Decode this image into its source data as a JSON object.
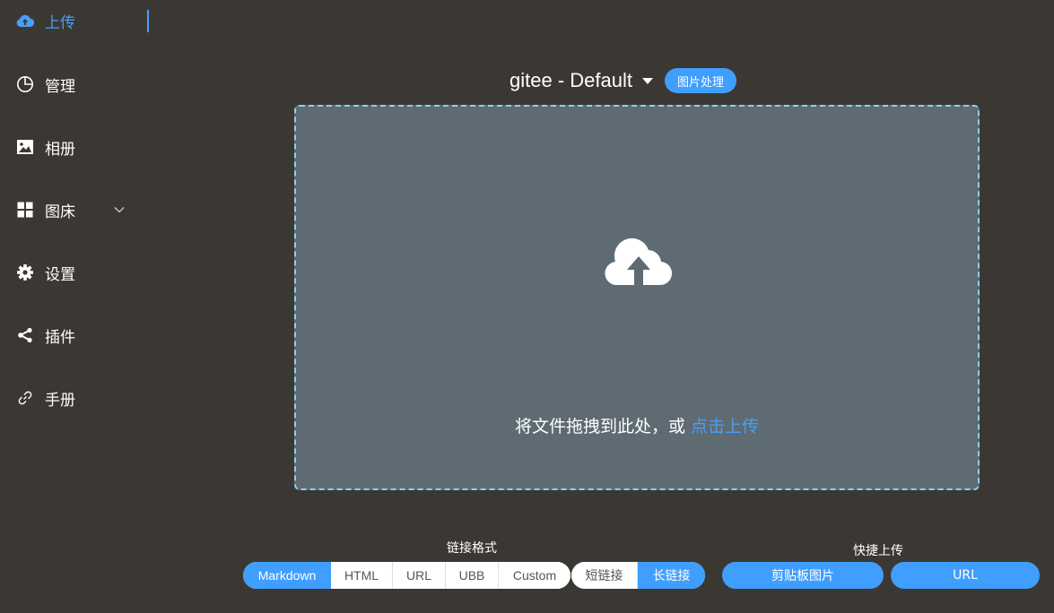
{
  "sidebar": {
    "items": [
      {
        "label": "上传",
        "icon": "cloud-upload-icon"
      },
      {
        "label": "管理",
        "icon": "pie-chart-icon"
      },
      {
        "label": "相册",
        "icon": "picture-icon"
      },
      {
        "label": "图床",
        "icon": "grid-icon"
      },
      {
        "label": "设置",
        "icon": "gear-icon"
      },
      {
        "label": "插件",
        "icon": "share-icon"
      },
      {
        "label": "手册",
        "icon": "link-icon"
      }
    ],
    "active_index": 0
  },
  "header": {
    "picbed_title": "gitee - Default",
    "process_button": "图片处理"
  },
  "dropzone": {
    "text": "将文件拖拽到此处，或 ",
    "link": "点击上传"
  },
  "link_format": {
    "label": "链接格式",
    "options": [
      "Markdown",
      "HTML",
      "URL",
      "UBB",
      "Custom"
    ],
    "selected": "Markdown"
  },
  "link_length": {
    "options": [
      "短链接",
      "长链接"
    ],
    "selected": "长链接"
  },
  "quick_upload": {
    "label": "快捷上传",
    "clipboard_button": "剪贴板图片",
    "url_button": "URL"
  },
  "colors": {
    "background": "#3b3834",
    "accent": "#409eff",
    "dropzone": "#5e6b72",
    "dropzone_border": "#8ecff2"
  }
}
